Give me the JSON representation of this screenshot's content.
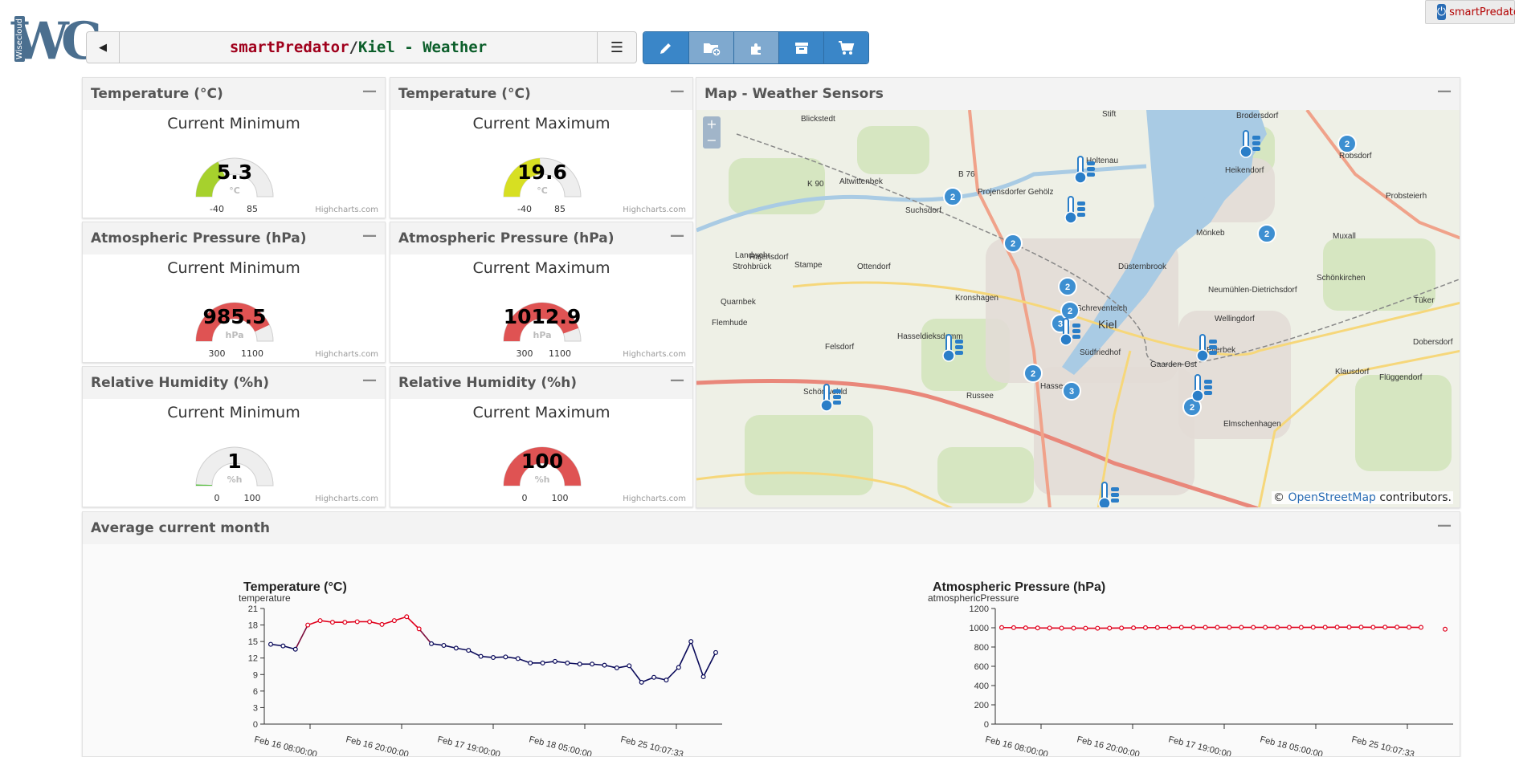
{
  "app": {
    "logo_letter": "WC",
    "logo_side_text": "Wisecloud",
    "login_label": "smartPredator"
  },
  "titlebar": {
    "project": "smartPredator",
    "separator": "/",
    "page": "Kiel - Weather"
  },
  "toolbar": {
    "buttons": [
      "edit-icon",
      "add-folder-icon",
      "puzzle-icon",
      "archive-icon",
      "cart-icon"
    ]
  },
  "gauges": [
    {
      "title": "Temperature (°C)",
      "subtitle": "Current Minimum",
      "value": "5.3",
      "unit": "°C",
      "min": "-40",
      "max": "85",
      "fraction": 0.36,
      "color": "#a6d12d"
    },
    {
      "title": "Temperature (°C)",
      "subtitle": "Current Maximum",
      "value": "19.6",
      "unit": "°C",
      "min": "-40",
      "max": "85",
      "fraction": 0.48,
      "color": "#d7df22"
    },
    {
      "title": "Atmospheric Pressure (hPa)",
      "subtitle": "Current Minimum",
      "value": "985.5",
      "unit": "hPa",
      "min": "300",
      "max": "1100",
      "fraction": 0.86,
      "color": "#df5353"
    },
    {
      "title": "Atmospheric Pressure (hPa)",
      "subtitle": "Current Maximum",
      "value": "1012.9",
      "unit": "hPa",
      "min": "300",
      "max": "1100",
      "fraction": 0.89,
      "color": "#df5353"
    },
    {
      "title": "Relative Humidity (%h)",
      "subtitle": "Current Minimum",
      "value": "1",
      "unit": "%h",
      "min": "0",
      "max": "100",
      "fraction": 0.01,
      "color": "#55bf3b"
    },
    {
      "title": "Relative Humidity (%h)",
      "subtitle": "Current Maximum",
      "value": "100",
      "unit": "%h",
      "min": "0",
      "max": "100",
      "fraction": 1.0,
      "color": "#df5353"
    }
  ],
  "credit": "Highcharts.com",
  "map": {
    "title": "Map - Weather Sensors",
    "attribution_prefix": "©",
    "attribution_link": "OpenStreetMap",
    "attribution_suffix": "contributors.",
    "zoom_in": "+",
    "zoom_out": "−",
    "places": [
      "Blickstedt",
      "Stift",
      "Brodersdorf",
      "Altwittenbek",
      "Holtenau",
      "Heikendorf",
      "Röbsdorf",
      "Probsteierh",
      "Suchsdorf",
      "Rajensdorf",
      "Landwehr",
      "Strohbrück",
      "Stampe",
      "Ottendorf",
      "Düsternbrook",
      "Mönkeb",
      "Muxall",
      "Schönkirchen",
      "Quarnbek",
      "Kronshagen",
      "Neumühlen-Dietrichsdorf",
      "Schreventeich",
      "Kiel",
      "Tüker",
      "Flemhude",
      "Hasseldieksdamm",
      "Wellingdorf",
      "Dobersdorf",
      "Felsdorf",
      "Südfriedhof",
      "Ellerbek",
      "Klausdorf",
      "Gaarden-Ost",
      "Flüggendorf",
      "Schönwohld",
      "Russee",
      "Hassee",
      "Elmschenhagen",
      "B 76",
      "K 90",
      "Projensdorfer Gehölz"
    ],
    "cluster_counts": [
      "2",
      "2",
      "2",
      "2",
      "2",
      "3",
      "2",
      "3",
      "2",
      "2"
    ]
  },
  "avg": {
    "title": "Average current month"
  },
  "chart_data": [
    {
      "type": "line",
      "title": "Temperature (°C)",
      "ylabel": "temperature",
      "ylim": [
        0,
        21
      ],
      "yticks": [
        "0",
        "3",
        "6",
        "9",
        "12",
        "15",
        "18",
        "21"
      ],
      "xticks": [
        "Feb 16 08:00:00",
        "Feb 16 20:00:00",
        "Feb 17 19:00:00",
        "Feb 18 05:00:00",
        "Feb 25 10:07:33"
      ],
      "values": [
        14.5,
        14.2,
        13.6,
        18.0,
        18.8,
        18.5,
        18.5,
        18.6,
        18.6,
        18.1,
        18.8,
        19.5,
        17.3,
        14.6,
        14.3,
        13.8,
        13.4,
        12.3,
        12.1,
        12.2,
        11.9,
        11.1,
        11.1,
        11.4,
        11.1,
        10.9,
        10.9,
        10.7,
        10.2,
        10.6,
        7.6,
        8.5,
        8.0,
        10.3,
        15.0,
        8.6,
        13.0
      ],
      "colors": {
        "high": "#e0001c",
        "low": "#0a0a5a"
      }
    },
    {
      "type": "line",
      "title": "Atmospheric Pressure (hPa)",
      "ylabel": "atmosphericPressure",
      "ylim": [
        0,
        1200
      ],
      "yticks": [
        "0",
        "200",
        "400",
        "600",
        "800",
        "1000",
        "1200"
      ],
      "xticks": [
        "Feb 16 08:00:00",
        "Feb 16 20:00:00",
        "Feb 17 19:00:00",
        "Feb 18 05:00:00",
        "Feb 25 10:07:33"
      ],
      "values": [
        1002,
        1001,
        999,
        998,
        997,
        996,
        996,
        995,
        995,
        996,
        997,
        999,
        1001,
        1002,
        1003,
        1004,
        1004,
        1004,
        1004,
        1004,
        1004,
        1004,
        1004,
        1004,
        1004,
        1004,
        1005,
        1005,
        1006,
        1006,
        1006,
        1005,
        1006,
        1006,
        1005,
        1004
      ],
      "outlier": 985,
      "colors": {
        "line": "#e0001c"
      }
    }
  ]
}
